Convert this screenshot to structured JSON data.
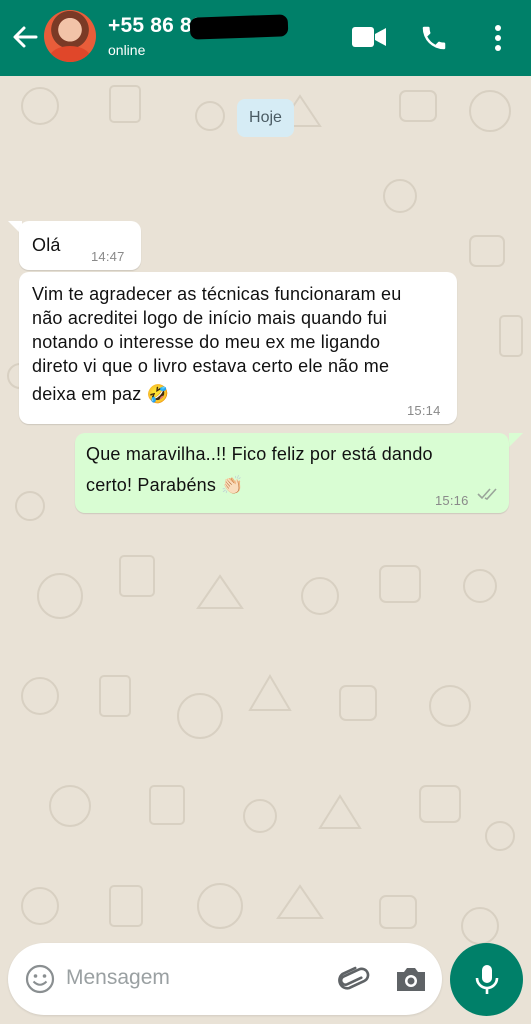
{
  "header": {
    "contact_name": "+55 86 88",
    "status": "online",
    "icons": [
      "back-arrow-icon",
      "video-call-icon",
      "phone-icon",
      "more-vert-icon"
    ],
    "color": "#008069"
  },
  "date_chip": "Hoje",
  "messages": [
    {
      "direction": "incoming",
      "text": "Olá",
      "time": "14:47"
    },
    {
      "direction": "incoming",
      "lines": [
        "Vim te agradecer as técnicas funcionaram eu",
        "não acreditei logo de início mais quando fui",
        "notando o interesse do meu ex me ligando",
        "direto vi que o livro estava certo ele não me",
        "deixa em paz 🤣"
      ],
      "time": "15:14"
    },
    {
      "direction": "outgoing",
      "lines": [
        "Que maravilha..!! Fico feliz por está dando",
        "certo! Parabéns 👏🏻"
      ],
      "time": "15:16",
      "status": "read"
    }
  ],
  "composer": {
    "placeholder": "Mensagem",
    "icons": [
      "emoji-icon",
      "attach-icon",
      "camera-icon",
      "mic-icon"
    ]
  },
  "colors": {
    "incoming_bubble": "#ffffff",
    "outgoing_bubble": "#d9fdd3",
    "wallpaper": "#e9e2d6"
  }
}
